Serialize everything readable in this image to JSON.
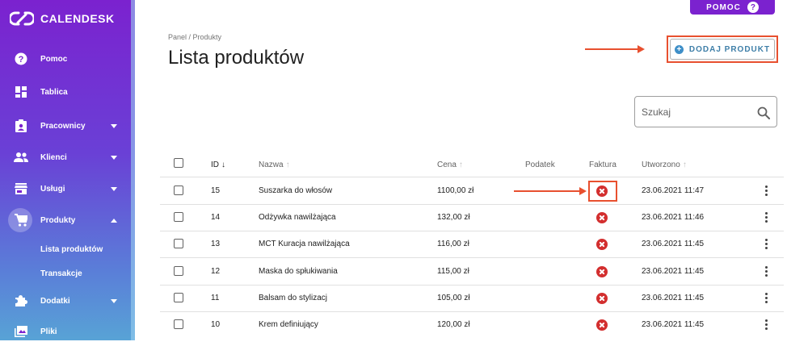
{
  "app": {
    "name": "CALENDESK"
  },
  "help_button": {
    "label": "POMOC",
    "icon": "question-icon"
  },
  "sidebar": {
    "items": [
      {
        "label": "Pomoc",
        "icon": "help-circle-icon"
      },
      {
        "label": "Tablica",
        "icon": "dashboard-icon"
      },
      {
        "label": "Pracownicy",
        "icon": "badge-icon"
      },
      {
        "label": "Klienci",
        "icon": "people-icon"
      },
      {
        "label": "Usługi",
        "icon": "store-icon"
      },
      {
        "label": "Produkty",
        "icon": "cart-icon"
      },
      {
        "label": "Dodatki",
        "icon": "puzzle-icon"
      },
      {
        "label": "Pliki",
        "icon": "image-icon"
      }
    ],
    "subitems": [
      {
        "label": "Lista produktów"
      },
      {
        "label": "Transakcje"
      }
    ]
  },
  "breadcrumb": "Panel / Produkty",
  "page_title": "Lista produktów",
  "add_button": {
    "label": "DODAJ PRODUKT",
    "icon": "plus-circle-icon"
  },
  "search": {
    "placeholder": "Szukaj",
    "icon": "search-icon"
  },
  "table": {
    "columns": {
      "id": "ID",
      "name": "Nazwa",
      "price": "Cena",
      "tax": "Podatek",
      "invoice": "Faktura",
      "created": "Utworzono"
    },
    "rows": [
      {
        "id": "15",
        "name": "Suszarka do włosów",
        "price": "1100,00 zł",
        "created": "23.06.2021 11:47"
      },
      {
        "id": "14",
        "name": "Odżywka nawilżająca",
        "price": "132,00 zł",
        "created": "23.06.2021 11:46"
      },
      {
        "id": "13",
        "name": "MCT Kuracja nawilżająca",
        "price": "116,00 zł",
        "created": "23.06.2021 11:45"
      },
      {
        "id": "12",
        "name": "Maska do spłukiwania",
        "price": "115,00 zł",
        "created": "23.06.2021 11:45"
      },
      {
        "id": "11",
        "name": "Balsam do stylizacj",
        "price": "105,00 zł",
        "created": "23.06.2021 11:45"
      },
      {
        "id": "10",
        "name": "Krem definiujący",
        "price": "120,00 zł",
        "created": "23.06.2021 11:45"
      }
    ]
  },
  "colors": {
    "brand": "#7b22cf",
    "annotation": "#e8502f",
    "invoice_off": "#d32f2f",
    "add_button_text": "#3f7fa8"
  }
}
